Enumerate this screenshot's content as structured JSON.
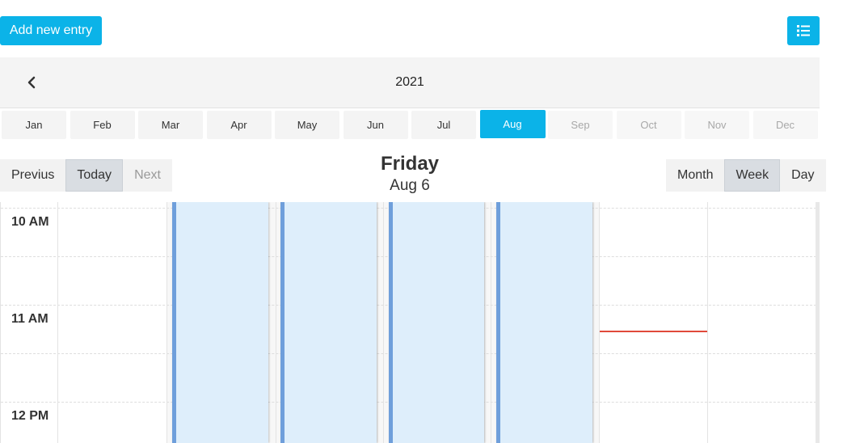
{
  "toolbar": {
    "add_label": "Add new entry",
    "list_icon": "list-icon"
  },
  "year_bar": {
    "year": "2021",
    "prev_icon": "chevron-left-icon"
  },
  "months": [
    {
      "label": "Jan",
      "state": "normal"
    },
    {
      "label": "Feb",
      "state": "normal"
    },
    {
      "label": "Mar",
      "state": "normal"
    },
    {
      "label": "Apr",
      "state": "normal"
    },
    {
      "label": "May",
      "state": "normal"
    },
    {
      "label": "Jun",
      "state": "normal"
    },
    {
      "label": "Jul",
      "state": "normal"
    },
    {
      "label": "Aug",
      "state": "active"
    },
    {
      "label": "Sep",
      "state": "muted"
    },
    {
      "label": "Oct",
      "state": "muted"
    },
    {
      "label": "Nov",
      "state": "muted"
    },
    {
      "label": "Dec",
      "state": "muted"
    }
  ],
  "nav": {
    "previous": "Previus",
    "today": "Today",
    "next": "Next"
  },
  "current": {
    "day_name": "Friday",
    "date": "Aug 6"
  },
  "views": {
    "month": "Month",
    "week": "Week",
    "day": "Day",
    "selected": "Week"
  },
  "times": [
    "10 AM",
    "11 AM",
    "12 PM"
  ],
  "colors": {
    "accent": "#0bb3e8",
    "event_fill": "#deeefb",
    "event_border": "#6f9fdb",
    "now_line": "#e04a3a"
  }
}
